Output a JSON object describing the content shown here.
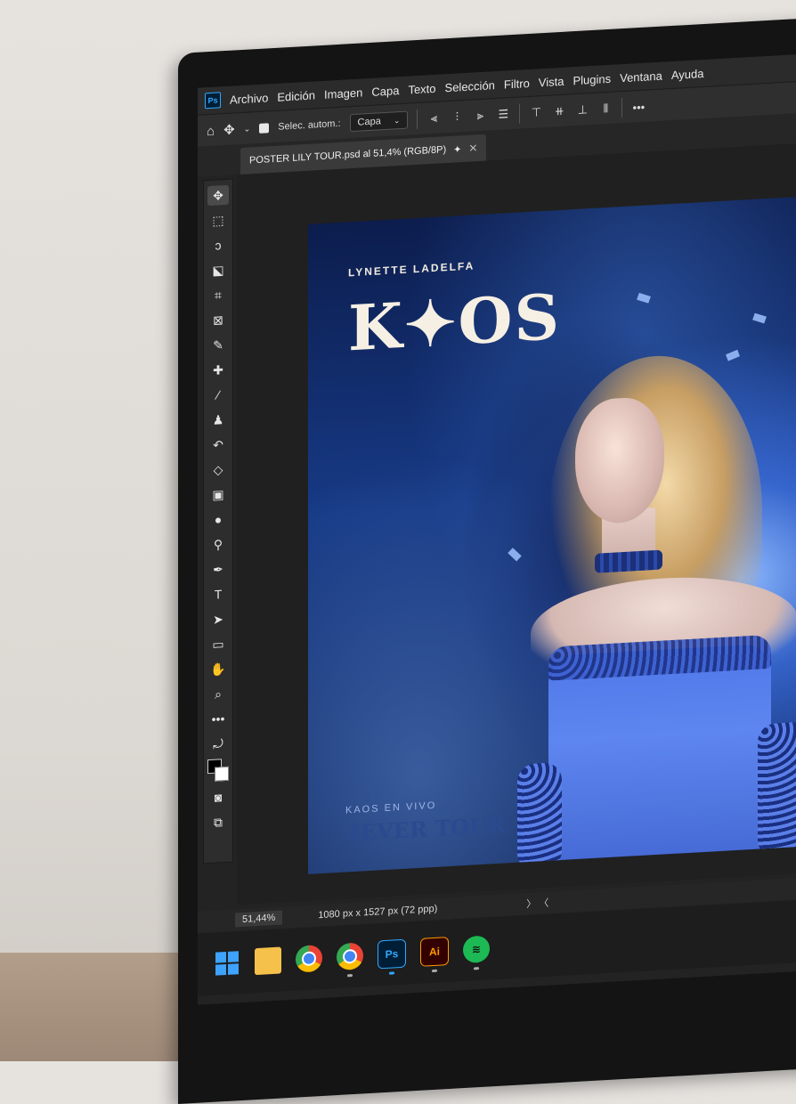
{
  "menu": {
    "items": [
      "Archivo",
      "Edición",
      "Imagen",
      "Capa",
      "Texto",
      "Selección",
      "Filtro",
      "Vista",
      "Plugins",
      "Ventana",
      "Ayuda"
    ]
  },
  "options": {
    "auto_select_label": "Selec. autom.:",
    "target_value": "Capa"
  },
  "document": {
    "tab_title": "POSTER LILY TOUR.psd al 51,4% (RGB/8P)",
    "modified_marker": "✦"
  },
  "poster": {
    "artist": "LYNETTE LADELFA",
    "title": "K✦OS",
    "subtitle": "KAOS EN VIVO",
    "tour": "4EVER TOUR"
  },
  "status": {
    "zoom": "51,44%",
    "dimensions": "1080 px x 1527 px (72 ppp)",
    "nav": "〉 〈"
  },
  "taskbar": {
    "ps_label": "Ps",
    "ai_label": "Ai"
  },
  "colors": {
    "accent_ps": "#31a8ff",
    "poster_bg": "#173a86",
    "dress": "#5e86f0"
  }
}
